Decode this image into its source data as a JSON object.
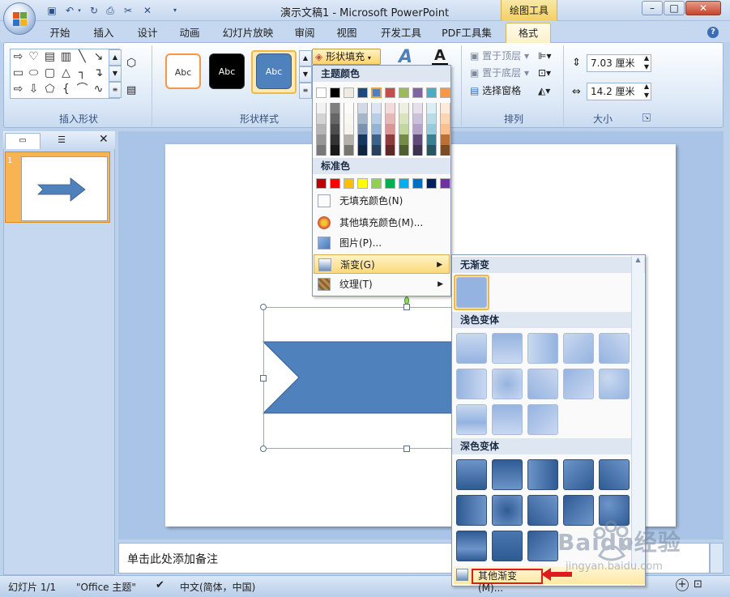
{
  "window": {
    "title": "演示文稿1 - Microsoft PowerPoint",
    "context_tool": "绘图工具",
    "controls": {
      "minimize": "–",
      "maximize": "□",
      "close": "✕"
    }
  },
  "tabs": [
    "开始",
    "插入",
    "设计",
    "动画",
    "幻灯片放映",
    "审阅",
    "视图",
    "开发工具",
    "PDF工具集",
    "格式"
  ],
  "active_tab": "格式",
  "ribbon": {
    "groups": {
      "insert_shapes": "插入形状",
      "shape_styles": "形状样式",
      "arrange": "排列",
      "size": "大小"
    },
    "style_thumbs": [
      "Abc",
      "Abc",
      "Abc"
    ],
    "shape_fill": "形状填充",
    "arrange": {
      "bring_front": "置于顶层",
      "send_back": "置于底层",
      "selection_pane": "选择窗格"
    },
    "size": {
      "height": "7.03 厘米",
      "width": "14.2 厘米"
    }
  },
  "slide_panel": {
    "slide_number": "1"
  },
  "fill_menu": {
    "theme_colors_header": "主题颜色",
    "standard_colors_header": "标准色",
    "theme_top": [
      "#ffffff",
      "#000000",
      "#eeece1",
      "#1f497d",
      "#4f81bd",
      "#c0504d",
      "#9bbb59",
      "#8064a2",
      "#4bacc6",
      "#f79646"
    ],
    "standard": [
      "#c00000",
      "#ff0000",
      "#ffc000",
      "#ffff00",
      "#92d050",
      "#00b050",
      "#00b0f0",
      "#0070c0",
      "#002060",
      "#7030a0"
    ],
    "items": {
      "no_fill": "无填充颜色(N)",
      "more_colors": "其他填充颜色(M)...",
      "picture": "图片(P)...",
      "gradient": "渐变(G)",
      "texture": "纹理(T)"
    }
  },
  "gradient_menu": {
    "no_gradient": "无渐变",
    "light_variations": "浅色变体",
    "dark_variations": "深色变体",
    "more_gradients": "其他渐变(M)..."
  },
  "notes_placeholder": "单击此处添加备注",
  "status": {
    "slide": "幻灯片 1/1",
    "theme": "\"Office 主题\"",
    "language": "中文(简体，中国)"
  },
  "watermark": {
    "brand": "Baidu经验",
    "url": "jingyan.baidu.com"
  },
  "colors": {
    "accent": "#4f81bd",
    "highlight": "#fbd97a",
    "annotation": "#e01b1b"
  }
}
